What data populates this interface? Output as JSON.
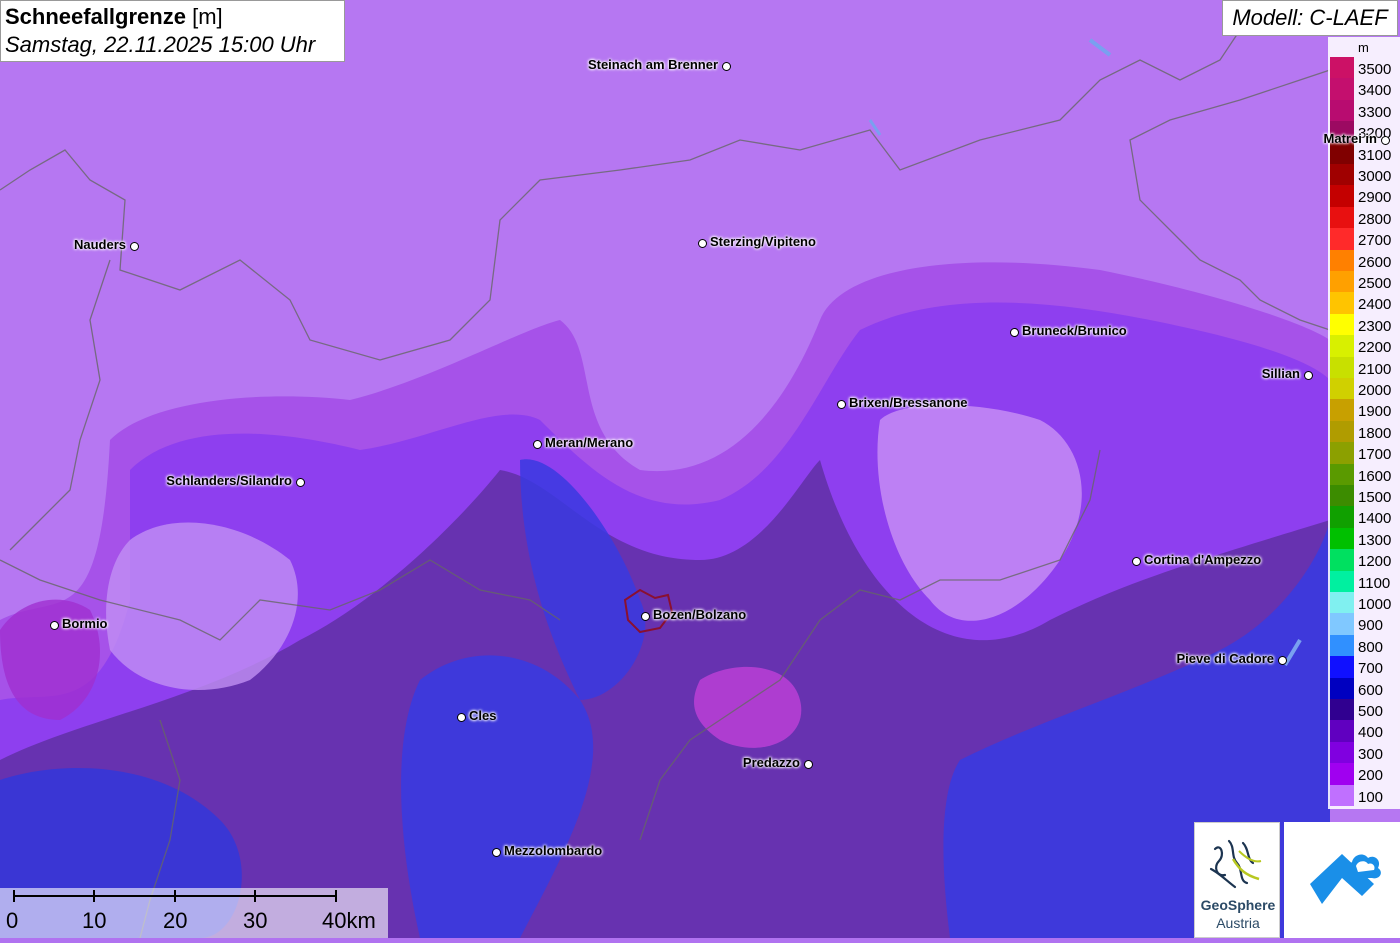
{
  "title": {
    "main": "Schneefallgrenze",
    "unit": "[m]",
    "subtitle": "Samstag, 22.11.2025 15:00 Uhr"
  },
  "model": "Modell: C-LAEF",
  "legend": {
    "unit": "m",
    "entries": [
      {
        "label": "3500",
        "color": "#cc1166"
      },
      {
        "label": "3400",
        "color": "#c40f6e"
      },
      {
        "label": "3300",
        "color": "#b80c70"
      },
      {
        "label": "3200",
        "color": "#9c0a62"
      },
      {
        "label": "3100",
        "color": "#800000"
      },
      {
        "label": "3000",
        "color": "#a00000"
      },
      {
        "label": "2900",
        "color": "#c40000"
      },
      {
        "label": "2800",
        "color": "#e81010"
      },
      {
        "label": "2700",
        "color": "#ff2a2a"
      },
      {
        "label": "2600",
        "color": "#ff8000"
      },
      {
        "label": "2500",
        "color": "#ffa000"
      },
      {
        "label": "2400",
        "color": "#ffc400"
      },
      {
        "label": "2300",
        "color": "#ffff00"
      },
      {
        "label": "2200",
        "color": "#d8f000"
      },
      {
        "label": "2100",
        "color": "#c8e000"
      },
      {
        "label": "2000",
        "color": "#d0d000"
      },
      {
        "label": "1900",
        "color": "#c8a000"
      },
      {
        "label": "1800",
        "color": "#b09c00"
      },
      {
        "label": "1700",
        "color": "#8ca000"
      },
      {
        "label": "1600",
        "color": "#5a9a00"
      },
      {
        "label": "1500",
        "color": "#3c8c00"
      },
      {
        "label": "1400",
        "color": "#10a000"
      },
      {
        "label": "1300",
        "color": "#00c000"
      },
      {
        "label": "1200",
        "color": "#00e060"
      },
      {
        "label": "1100",
        "color": "#00f0a0"
      },
      {
        "label": "1000",
        "color": "#80f0f0"
      },
      {
        "label": "900",
        "color": "#80c8ff"
      },
      {
        "label": "800",
        "color": "#3090ff"
      },
      {
        "label": "700",
        "color": "#1010ff"
      },
      {
        "label": "600",
        "color": "#0000c0"
      },
      {
        "label": "500",
        "color": "#300090"
      },
      {
        "label": "400",
        "color": "#6000c0"
      },
      {
        "label": "300",
        "color": "#8000e0"
      },
      {
        "label": "200",
        "color": "#a000f0"
      },
      {
        "label": "100",
        "color": "#c070ff"
      }
    ]
  },
  "cities": [
    {
      "name": "Steinach am Brenner"
    },
    {
      "name": "Matrei in"
    },
    {
      "name": "Nauders"
    },
    {
      "name": "Sterzing/Vipiteno"
    },
    {
      "name": "Bruneck/Brunico"
    },
    {
      "name": "Sillian"
    },
    {
      "name": "Brixen/Bressanone"
    },
    {
      "name": "Meran/Merano"
    },
    {
      "name": "Schlanders/Silandro"
    },
    {
      "name": "Cortina d'Ampezzo"
    },
    {
      "name": "Bozen/Bolzano"
    },
    {
      "name": "Bormio"
    },
    {
      "name": "Pieve di Cadore"
    },
    {
      "name": "Cles"
    },
    {
      "name": "Predazzo"
    },
    {
      "name": "Mezzolombardo"
    }
  ],
  "scale": {
    "labels": [
      "0",
      "10",
      "20",
      "30",
      "40km"
    ]
  },
  "logo": {
    "line1": "GeoSphere",
    "line2": "Austria"
  }
}
